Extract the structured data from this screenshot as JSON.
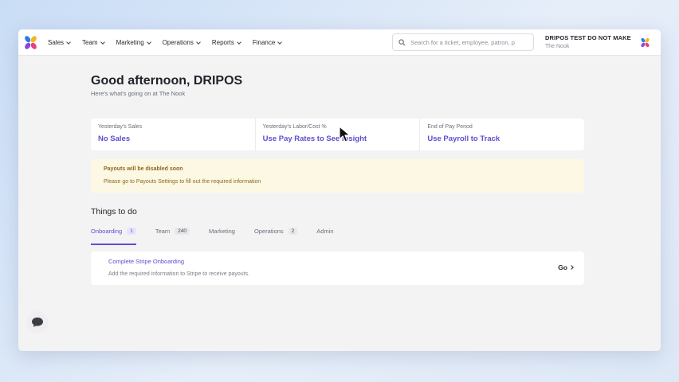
{
  "nav": {
    "items": [
      {
        "label": "Sales"
      },
      {
        "label": "Team"
      },
      {
        "label": "Marketing"
      },
      {
        "label": "Operations"
      },
      {
        "label": "Reports"
      },
      {
        "label": "Finance"
      }
    ]
  },
  "search": {
    "placeholder": "Search for a ticket, employee, patron, p",
    "icon": "search-icon"
  },
  "account": {
    "name": "DRIPOS TEST DO NOT MAKE",
    "location": "The Nook"
  },
  "greeting": {
    "title": "Good afternoon, DRIPOS",
    "subtitle": "Here's what's going on at The Nook"
  },
  "stats": [
    {
      "label": "Yesterday's Sales",
      "value": "No Sales"
    },
    {
      "label": "Yesterday's Labor/Cost %",
      "value": "Use Pay Rates to See Insight"
    },
    {
      "label": "End of Pay Period",
      "value": "Use Payroll to Track"
    }
  ],
  "alert": {
    "title": "Payouts will be disabled soon",
    "body": "Please go to Payouts Settings to fill out the required information"
  },
  "todo": {
    "title": "Things to do",
    "tabs": [
      {
        "label": "Onboarding",
        "count": "1"
      },
      {
        "label": "Team",
        "count": "240"
      },
      {
        "label": "Marketing",
        "count": ""
      },
      {
        "label": "Operations",
        "count": "2"
      },
      {
        "label": "Admin",
        "count": ""
      }
    ],
    "task": {
      "title": "Complete Stripe Onboarding",
      "description": "Add the required information to Stripe to receive payouts.",
      "action": "Go"
    }
  },
  "colors": {
    "accent": "#5b4ed1",
    "alert_bg": "#fdf8e4",
    "alert_text": "#8a6a1a"
  }
}
